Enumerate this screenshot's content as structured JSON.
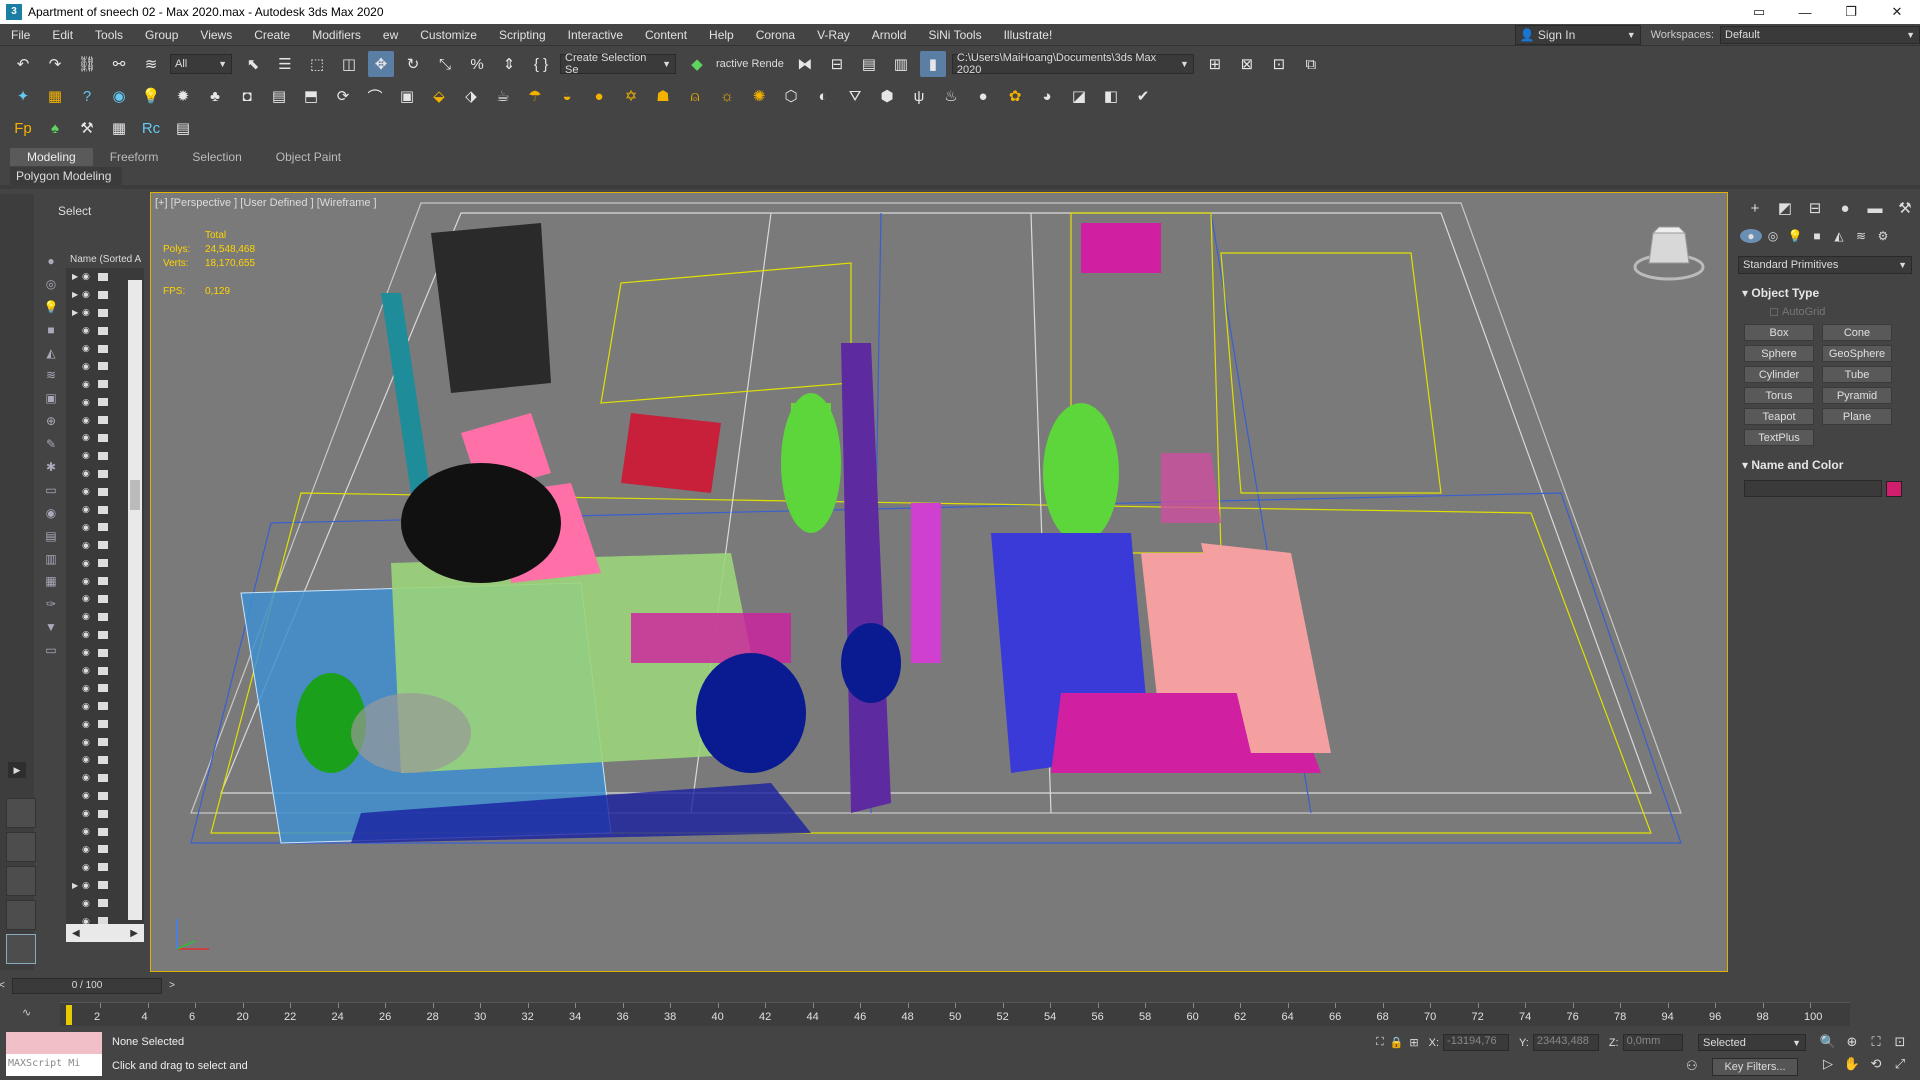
{
  "window": {
    "title": "Apartment of sneech 02 - Max 2020.max - Autodesk 3ds Max 2020",
    "controls": [
      "▭",
      "—",
      "❐",
      "✕"
    ]
  },
  "menu": {
    "items": [
      "File",
      "Edit",
      "Tools",
      "Group",
      "Views",
      "Create",
      "Modifiers",
      "ew",
      "Customize",
      "Scripting",
      "Interactive",
      "Content",
      "Help",
      "Corona",
      "V-Ray",
      "Arnold",
      "SiNi Tools",
      "Illustrate!"
    ],
    "sign_in": "Sign In",
    "workspaces_label": "Workspaces:",
    "workspace_value": "Default"
  },
  "toolbar": {
    "filter_value": "All",
    "selection_set": "Create Selection Se",
    "interactive_render": "ractive Rende",
    "project_path": "C:\\Users\\MaiHoang\\Documents\\3ds Max 2020"
  },
  "ribbon": {
    "tabs": [
      "Modeling",
      "Freeform",
      "Selection",
      "Object Paint"
    ],
    "subtab": "Polygon Modeling"
  },
  "scene_explorer": {
    "header": "Select",
    "column_header": "Name (Sorted A"
  },
  "viewport": {
    "label": "[+] [Perspective ] [User Defined ] [Wireframe ]",
    "stats": {
      "total_label": "Total",
      "polys_label": "Polys:",
      "polys_value": "24,548,468",
      "verts_label": "Verts:",
      "verts_value": "18,170,655",
      "fps_label": "FPS:",
      "fps_value": "0,129"
    }
  },
  "command_panel": {
    "dropdown": "Standard Primitives",
    "object_type_title": "Object Type",
    "autogrid": "AutoGrid",
    "primitives": [
      "Box",
      "Cone",
      "Sphere",
      "GeoSphere",
      "Cylinder",
      "Tube",
      "Torus",
      "Pyramid",
      "Teapot",
      "Plane",
      "TextPlus"
    ],
    "name_color_title": "Name and Color",
    "object_color": "#d11e6e"
  },
  "timeline": {
    "slider": "0 / 100",
    "ticks": [
      "2",
      "4",
      "6",
      "20",
      "22",
      "24",
      "26",
      "28",
      "30",
      "32",
      "34",
      "36",
      "38",
      "40",
      "42",
      "44",
      "46",
      "48",
      "50",
      "52",
      "54",
      "56",
      "58",
      "60",
      "62",
      "64",
      "66",
      "68",
      "70",
      "72",
      "74",
      "76",
      "78",
      "94",
      "96",
      "98",
      "100"
    ]
  },
  "status": {
    "maxscript": "MAXScript Mi",
    "selection": "None Selected",
    "prompt": "Click and drag to select and",
    "x_label": "X:",
    "x_value": "-13194,76",
    "y_label": "Y:",
    "y_value": "23443,488",
    "z_label": "Z:",
    "z_value": "0,0mm",
    "selected_dropdown": "Selected",
    "key_filters": "Key Filters..."
  }
}
